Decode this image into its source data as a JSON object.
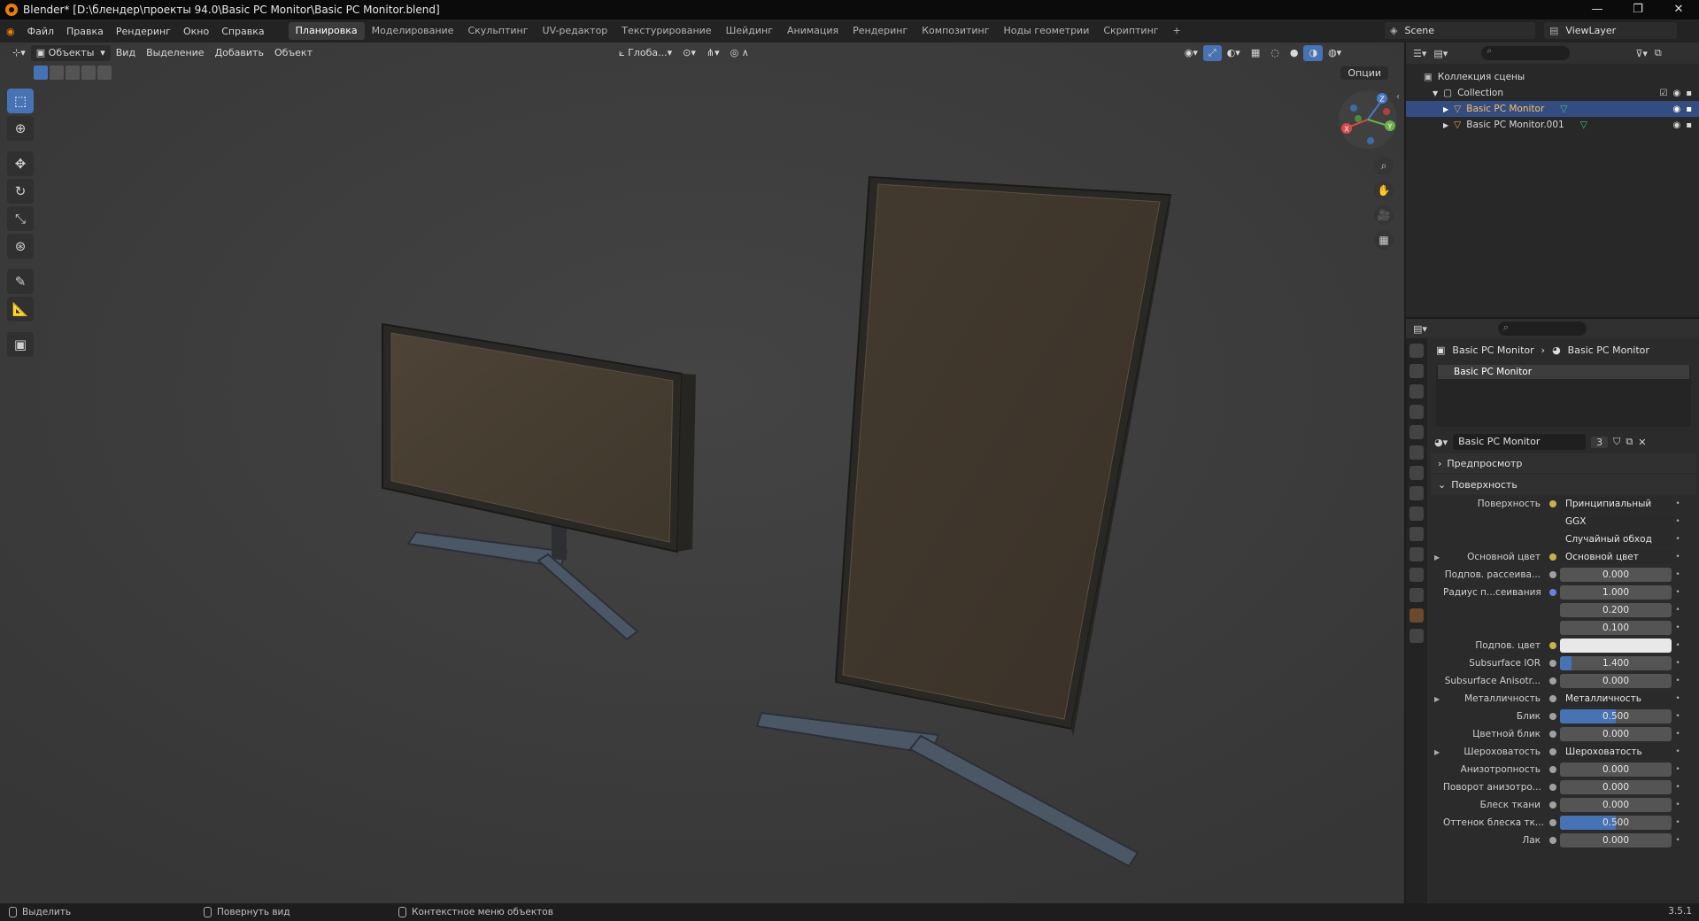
{
  "window": {
    "title": "Blender* [D:\\блендер\\проекты 94.0\\Basic PC Monitor\\Basic PC Monitor.blend]",
    "controls": [
      "—",
      "❐",
      "✕"
    ]
  },
  "menu": {
    "items": [
      "Файл",
      "Правка",
      "Рендеринг",
      "Окно",
      "Справка"
    ],
    "workspaces": [
      "Планировка",
      "Моделирование",
      "Скульптинг",
      "UV-редактор",
      "Текстурирование",
      "Шейдинг",
      "Анимация",
      "Рендеринг",
      "Композитинг",
      "Ноды геометрии",
      "Скриптинг"
    ],
    "active_workspace": "Планировка",
    "add_tab": "+",
    "scene": "Scene",
    "view_layer": "ViewLayer"
  },
  "viewport": {
    "mode": "Объекты",
    "menus": [
      "Вид",
      "Выделение",
      "Добавить",
      "Объект"
    ],
    "orientation": "Глоба...",
    "options": "Опции",
    "gizmo_axes": [
      "X",
      "Y",
      "Z"
    ]
  },
  "outliner": {
    "root": "Коллекция сцены",
    "collection": "Collection",
    "objects": [
      {
        "name": "Basic PC Monitor",
        "selected": true
      },
      {
        "name": "Basic PC Monitor.001",
        "selected": false
      }
    ]
  },
  "properties": {
    "breadcrumb_object": "Basic PC Monitor",
    "breadcrumb_material": "Basic PC Monitor",
    "slot": "Basic PC Monitor",
    "material_name": "Basic PC Monitor",
    "users": "3",
    "sections": {
      "preview": "Предпросмотр",
      "surface": "Поверхность"
    },
    "rows": [
      {
        "label": "Поверхность",
        "value": "Принципиальный BSDF",
        "kind": "dark",
        "dot": "yellow"
      },
      {
        "label": "",
        "value": "GGX",
        "kind": "dark",
        "dot": "none"
      },
      {
        "label": "",
        "value": "Случайный обход",
        "kind": "dark",
        "dot": "none"
      },
      {
        "label": "Основной цвет",
        "value": "Основной цвет",
        "kind": "dark",
        "dot": "yellow",
        "expand": true
      },
      {
        "label": "Подпов. рассеива...",
        "value": "0.000",
        "kind": "num",
        "dot": "gray"
      },
      {
        "label": "Радиус п...сеивания",
        "value": "1.000",
        "kind": "num",
        "dot": "blue"
      },
      {
        "label": "",
        "value": "0.200",
        "kind": "num",
        "dot": "none"
      },
      {
        "label": "",
        "value": "0.100",
        "kind": "num",
        "dot": "none"
      },
      {
        "label": "Подпов. цвет",
        "value": "",
        "kind": "white",
        "dot": "yellow"
      },
      {
        "label": "Subsurface IOR",
        "value": "1.400",
        "kind": "num",
        "dot": "gray",
        "fill": 0.1
      },
      {
        "label": "Subsurface Anisotr...",
        "value": "0.000",
        "kind": "num",
        "dot": "gray"
      },
      {
        "label": "Металличность",
        "value": "Металличность",
        "kind": "dark",
        "dot": "gray",
        "expand": true
      },
      {
        "label": "Блик",
        "value": "0.500",
        "kind": "num",
        "dot": "gray",
        "fill": 0.5
      },
      {
        "label": "Цветной блик",
        "value": "0.000",
        "kind": "num",
        "dot": "gray"
      },
      {
        "label": "Шероховатость",
        "value": "Шероховатость",
        "kind": "dark",
        "dot": "gray",
        "expand": true
      },
      {
        "label": "Анизотропность",
        "value": "0.000",
        "kind": "num",
        "dot": "gray"
      },
      {
        "label": "Поворот анизотро...",
        "value": "0.000",
        "kind": "num",
        "dot": "gray"
      },
      {
        "label": "Блеск ткани",
        "value": "0.000",
        "kind": "num",
        "dot": "gray"
      },
      {
        "label": "Оттенок блеска тк...",
        "value": "0.500",
        "kind": "num",
        "dot": "gray",
        "fill": 0.5
      },
      {
        "label": "Лак",
        "value": "0.000",
        "kind": "num",
        "dot": "gray"
      }
    ]
  },
  "status": {
    "items": [
      "Выделить",
      "Повернуть вид",
      "Контекстное меню объектов"
    ],
    "version": "3.5.1"
  }
}
